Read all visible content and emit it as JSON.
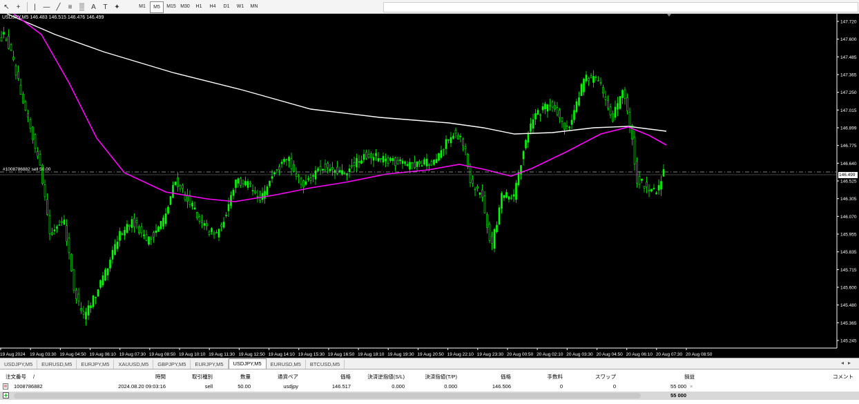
{
  "toolbar": {
    "icons": [
      "cursor-icon",
      "crosshair-icon",
      "vertical-line-icon",
      "horizontal-line-icon",
      "trendline-icon",
      "fibonacci-icon",
      "channel-icon",
      "text-icon",
      "label-icon",
      "shapes-icon"
    ],
    "timeframes": [
      "M1",
      "M5",
      "M15",
      "M30",
      "H1",
      "H4",
      "D1",
      "W1",
      "MN"
    ],
    "active_timeframe": "M5"
  },
  "chart": {
    "symbol_info": "USDJPY,M5  146.483 146.515 146.476 146.499",
    "order_line_label": "#1008786882 sell 50.00",
    "current_price": "146.499",
    "price_ticks": [
      "147.720",
      "147.600",
      "147.485",
      "147.365",
      "147.250",
      "147.015",
      "146.899",
      "146.775",
      "146.640",
      "146.525",
      "146.305",
      "146.070",
      "145.955",
      "145.835",
      "145.715",
      "145.600",
      "145.480",
      "145.365",
      "145.245"
    ],
    "time_ticks": [
      "19 Aug 2024",
      "19 Aug 03:30",
      "19 Aug 04:50",
      "19 Aug 06:10",
      "19 Aug 07:30",
      "19 Aug 08:50",
      "19 Aug 10:10",
      "19 Aug 11:30",
      "19 Aug 12:50",
      "19 Aug 14:10",
      "19 Aug 15:30",
      "19 Aug 16:50",
      "19 Aug 18:10",
      "19 Aug 19:30",
      "19 Aug 20:50",
      "19 Aug 22:10",
      "19 Aug 23:30",
      "20 Aug 00:50",
      "20 Aug 02:10",
      "20 Aug 03:30",
      "20 Aug 04:50",
      "20 Aug 06:10",
      "20 Aug 07:30",
      "20 Aug 08:50"
    ],
    "colors": {
      "background": "#000000",
      "candles": "#00ff00",
      "ma_fast": "#ff00ff",
      "ma_slow": "#ffffff",
      "axis_text": "#ffffff"
    }
  },
  "tabs": [
    "USDJPY,M5",
    "EURUSD,M5",
    "EURJPY,M5",
    "XAUUSD,M5",
    "GBPJPY,M5",
    "EURJPY,M5",
    "USDJPY,M5",
    "EURUSD,M5",
    "BTCUSD,M5"
  ],
  "active_tab_index": 6,
  "terminal": {
    "headers": {
      "order": "注文番号",
      "sort": "/",
      "time": "時間",
      "type": "取引種別",
      "volume": "数量",
      "pair": "通貨ペア",
      "price": "価格",
      "sl": "決済逆指値(S/L)",
      "tp": "決済指値(T/P)",
      "cur_price": "価格",
      "commission": "手数料",
      "swap": "スワップ",
      "profit": "損益",
      "comment": "コメント"
    },
    "order": {
      "order": "1008786882",
      "time": "2024.08.20 09:03:16",
      "type": "sell",
      "volume": "50.00",
      "pair": "usdjpy",
      "price": "146.517",
      "sl": "0.000",
      "tp": "0.000",
      "cur_price": "146.506",
      "commission": "0",
      "swap": "0",
      "profit": "55 000",
      "close": "×"
    },
    "summary_profit": "55 000"
  }
}
